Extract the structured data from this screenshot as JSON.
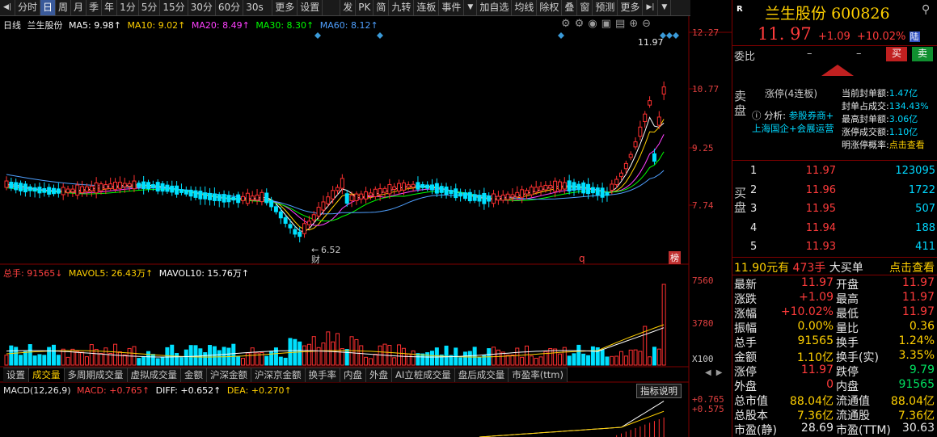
{
  "toolbar": {
    "items": [
      "分时",
      "日",
      "周",
      "月",
      "季",
      "年",
      "1分",
      "5分",
      "15分",
      "30分",
      "60分",
      "30s",
      "更多",
      "设置"
    ],
    "right_items": [
      "发",
      "PK",
      "简",
      "九转",
      "连板",
      "事件",
      "加自选",
      "均线",
      "除权",
      "叠",
      "窗",
      "预测",
      "更多"
    ]
  },
  "chart": {
    "period": "日线",
    "name": "兰生股份",
    "ma5": "MA5: 9.98↑",
    "ma10": "MA10: 9.02↑",
    "ma20": "MA20: 8.49↑",
    "ma30": "MA30: 8.30↑",
    "ma60": "MA60: 8.12↑",
    "price_labels": [
      "12.27",
      "10.77",
      "9.25",
      "7.74"
    ],
    "high_marker": "11.97",
    "low_marker": "6.52",
    "low_tag": "财",
    "q_tag": "q",
    "bang_tag": "榜",
    "colors": {
      "ma5": "#ffffff",
      "ma10": "#ffd000",
      "ma20": "#ff40ff",
      "ma30": "#00ff00",
      "ma60": "#4fa0ff"
    }
  },
  "volume": {
    "total": "总手: 91565↓",
    "mavol5": "MAVOL5: 26.43万↑",
    "mavol10": "MAVOL10: 15.76万↑",
    "labels": [
      "7560",
      "3780",
      "X100"
    ]
  },
  "ind_tabs": [
    "设置",
    "成交量",
    "多周期成交量",
    "虚拟成交量",
    "金额",
    "沪深金额",
    "沪深京金额",
    "换手率",
    "内盘",
    "外盘",
    "AI立桩成交量",
    "盘后成交量",
    "市盈率(ttm)"
  ],
  "macd": {
    "title": "MACD(12,26,9)",
    "macd": "MACD: +0.765↑",
    "diff": "DIFF: +0.652↑",
    "dea": "DEA: +0.270↑",
    "explain": "指标说明",
    "labels": [
      "+0.765",
      "+0.575"
    ]
  },
  "panel": {
    "r_badge": "R",
    "stock_name": "兰生股份",
    "code": "600826",
    "price": "11. 97",
    "change": "+1.09",
    "pct": "+10.02%",
    "flag": "陆",
    "weibi": "委比",
    "dash1": "–",
    "dash2": "–",
    "buy_btn": "买",
    "sell_btn": "卖",
    "sell_label": "卖盘",
    "limit_title": "涨停(4连板)",
    "analysis_prefix": "分析:",
    "analysis_link": "参股券商+",
    "analysis_line2": "上海国企+会展运营",
    "seal_rows": [
      {
        "k": "当前封单额:",
        "v": "1.47亿"
      },
      {
        "k": "封单占成交:",
        "v": "134.43%"
      },
      {
        "k": "最高封单额:",
        "v": "3.06亿"
      },
      {
        "k": "涨停成交额:",
        "v": "1.10亿"
      },
      {
        "k": "明涨停概率:",
        "v": "点击查看"
      }
    ],
    "buy_label": "买盘",
    "bids": [
      {
        "lvl": "1",
        "price": "11.97",
        "vol": "123095"
      },
      {
        "lvl": "2",
        "price": "11.96",
        "vol": "1722"
      },
      {
        "lvl": "3",
        "price": "11.95",
        "vol": "507"
      },
      {
        "lvl": "4",
        "price": "11.94",
        "vol": "188"
      },
      {
        "lvl": "5",
        "price": "11.93",
        "vol": "411"
      }
    ],
    "big_order": {
      "price": "11.90元有",
      "qty": "473手",
      "label": "大买单",
      "link": "点击查看"
    },
    "stats": [
      {
        "k1": "最新",
        "v1": "11.97",
        "c1": "red",
        "k2": "开盘",
        "v2": "11.97",
        "c2": "red"
      },
      {
        "k1": "涨跌",
        "v1": "+1.09",
        "c1": "red",
        "k2": "最高",
        "v2": "11.97",
        "c2": "red"
      },
      {
        "k1": "涨幅",
        "v1": "+10.02%",
        "c1": "red",
        "k2": "最低",
        "v2": "11.97",
        "c2": "red"
      },
      {
        "k1": "振幅",
        "v1": "0.00%",
        "c1": "yellow",
        "k2": "量比",
        "v2": "0.36",
        "c2": "yellow"
      },
      {
        "k1": "总手",
        "v1": "91565",
        "c1": "yellow",
        "k2": "换手",
        "v2": "1.24%",
        "c2": "yellow"
      },
      {
        "k1": "金额",
        "v1": "1.10亿",
        "c1": "yellow",
        "k2": "换手(实)",
        "v2": "3.35%",
        "c2": "yellow"
      },
      {
        "k1": "涨停",
        "v1": "11.97",
        "c1": "red",
        "k2": "跌停",
        "v2": "9.79",
        "c2": "green"
      },
      {
        "k1": "外盘",
        "v1": "0",
        "c1": "red",
        "k2": "内盘",
        "v2": "91565",
        "c2": "green"
      },
      {
        "k1": "总市值",
        "v1": "88.04亿",
        "c1": "yellow",
        "k2": "流通值",
        "v2": "88.04亿",
        "c2": "yellow"
      },
      {
        "k1": "总股本",
        "v1": "7.36亿",
        "c1": "yellow",
        "k2": "流通股",
        "v2": "7.36亿",
        "c2": "yellow"
      },
      {
        "k1": "市盈(静)",
        "v1": "28.69",
        "c1": "white",
        "k2": "市盈(TTM)",
        "v2": "30.63",
        "c2": "white"
      }
    ]
  }
}
